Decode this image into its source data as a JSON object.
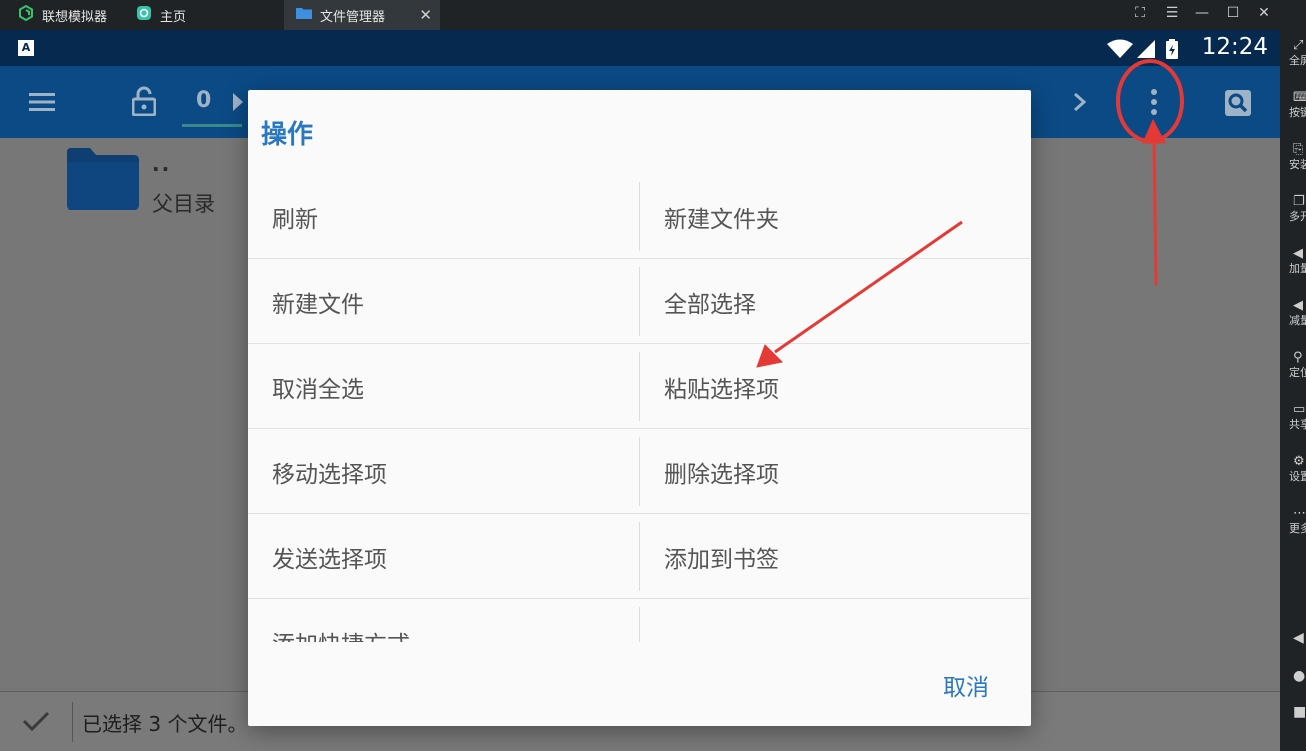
{
  "titlebar": {
    "tabs": [
      {
        "label": "联想模拟器"
      },
      {
        "label": "主页"
      },
      {
        "label": "文件管理器"
      }
    ]
  },
  "statusbar": {
    "time": "12:24"
  },
  "toolbar": {
    "counter": "0"
  },
  "content": {
    "parent_dots": "..",
    "parent_label": "父目录"
  },
  "bottom": {
    "selection_text": "已选择 3 个文件。"
  },
  "dialog": {
    "title": "操作",
    "items": [
      "刷新",
      "新建文件夹",
      "新建文件",
      "全部选择",
      "取消全选",
      "粘贴选择项",
      "移动选择项",
      "删除选择项",
      "发送选择项",
      "添加到书签",
      "添加快捷方式",
      ""
    ],
    "cancel_label": "取消"
  },
  "sidebar": {
    "items": [
      "全屏",
      "按键",
      "安装",
      "多开",
      "加量",
      "减量",
      "定位",
      "共享",
      "设置",
      "更多"
    ]
  },
  "colors": {
    "accent": "#2a78c2",
    "toolbar": "#0b4a85",
    "statusbar": "#06294f",
    "annotation": "#e53935"
  }
}
